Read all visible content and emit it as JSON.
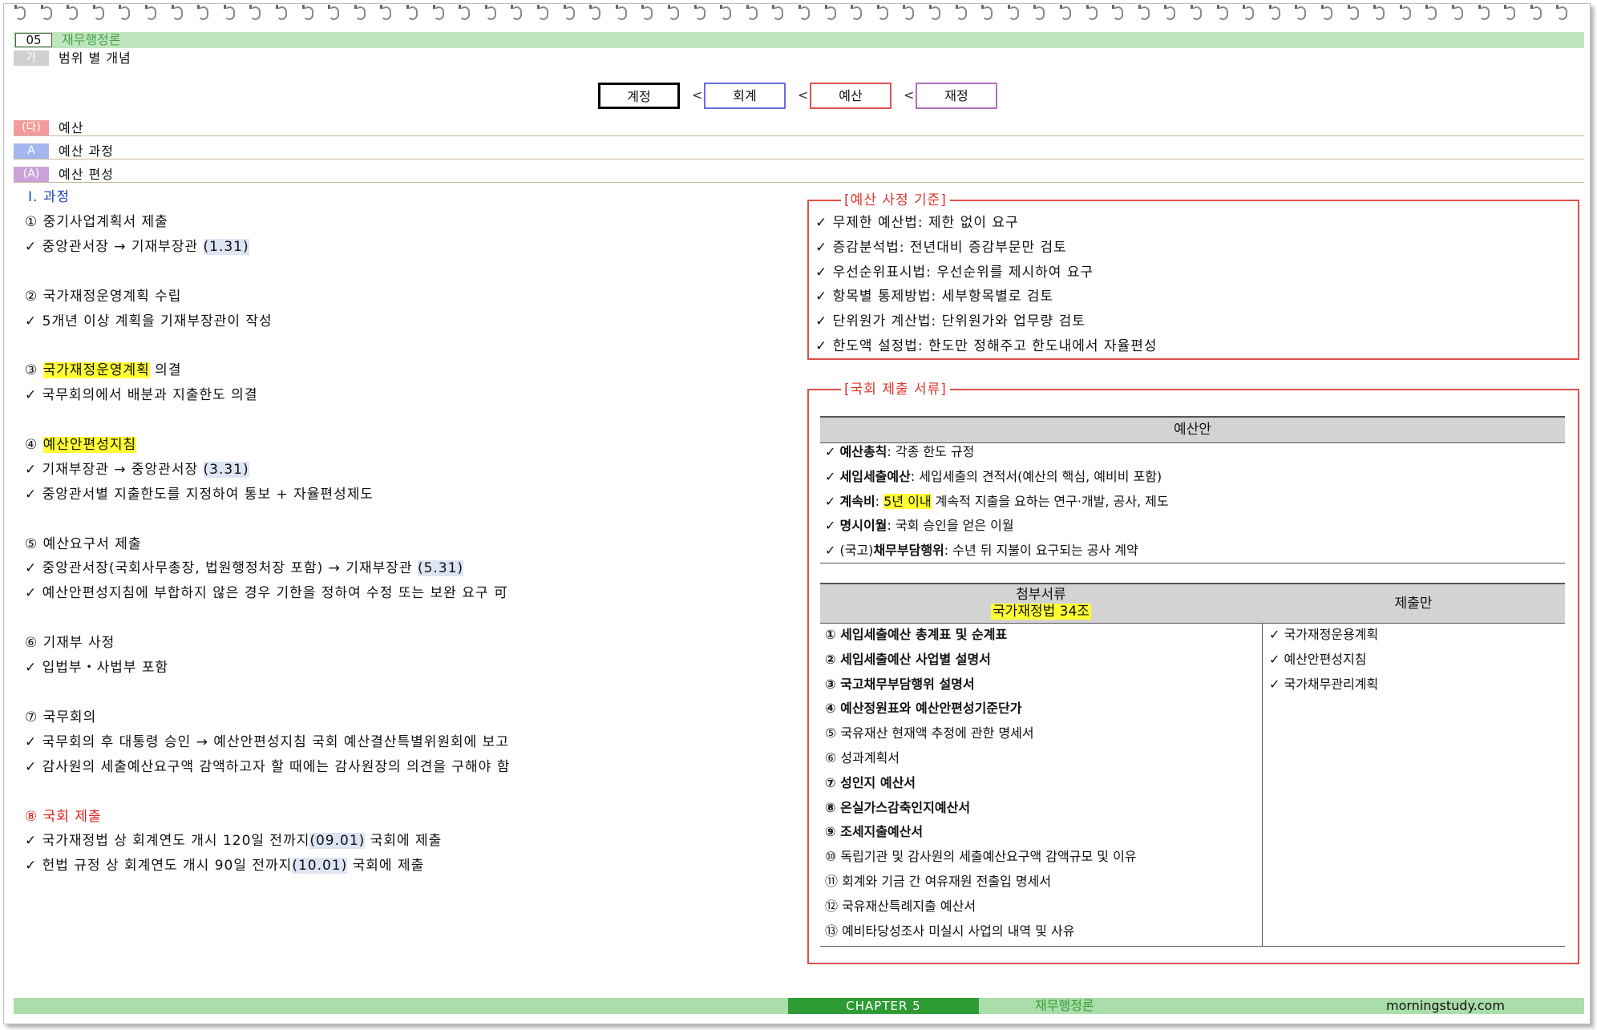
{
  "header": {
    "chapter_num": "05",
    "chapter_title": "재무행정론"
  },
  "sections": [
    {
      "tag": "가",
      "label": "범위 별 개념"
    },
    {
      "tag": "(다)",
      "label": "예산"
    },
    {
      "tag": "A",
      "label": "예산 과정"
    },
    {
      "tag": "(A)",
      "label": "예산 편성"
    }
  ],
  "scope_boxes": [
    {
      "label": "계정",
      "color": "#000000"
    },
    {
      "label": "회계",
      "color": "#6a6ae0"
    },
    {
      "label": "예산",
      "color": "#e05050"
    },
    {
      "label": "재정",
      "color": "#b070c0"
    }
  ],
  "lt_symbol": "<",
  "process": {
    "title": "Ⅰ. 과정",
    "s1": {
      "head": "① 중기사업계획서 제출",
      "c1a": "✓ 중앙관서장 → 기재부장관 ",
      "c1b": "(1.31)"
    },
    "s2": {
      "head": "② 국가재정운영계획 수립",
      "c1": "✓ 5개년 이상 계획을 기재부장관이 작성"
    },
    "s3": {
      "num": "③ ",
      "hl": "국가재정운영계획",
      "rest": " 의결",
      "c1": "✓ 국무회의에서 배분과 지출한도 의결"
    },
    "s4": {
      "num": "④ ",
      "hl": "예산안편성지침",
      "c1a": "✓ 기재부장관 → 중앙관서장 ",
      "c1b": "(3.31)",
      "c2": "✓ 중앙관서별 지출한도를 지정하여 통보 + 자율편성제도"
    },
    "s5": {
      "head": "⑤ 예산요구서 제출",
      "c1a": "✓ 중앙관서장(국회사무총장, 법원행정처장 포함) → 기재부장관 ",
      "c1b": "(5.31)",
      "c2": "✓ 예산안편성지침에 부합하지 않은 경우 기한을 정하여 수정 또는 보완 요구 可"
    },
    "s6": {
      "head": "⑥ 기재부 사정",
      "c1": "✓ 입법부・사법부 포함"
    },
    "s7": {
      "head": "⑦ 국무회의",
      "c1": "✓ 국무회의 후 대통령 승인 → 예산안편성지침 국회 예산결산특별위원회에 보고",
      "c2": "✓ 감사원의 세출예산요구액 감액하고자 할 때에는 감사원장의 의견을 구해야 함"
    },
    "s8": {
      "head": "⑧ 국회 제출",
      "c1a": "✓ 국가재정법 상 회계연도 개시 120일 전까지",
      "c1b": "(09.01)",
      "c1c": " 국회에 제출",
      "c2a": "✓ 헌법 규정 상 회계연도 개시 90일 전까지",
      "c2b": "(10.01)",
      "c2c": " 국회에 제출"
    }
  },
  "criteria": {
    "legend": "[예산 사정 기준]",
    "items": [
      "✓ 무제한 예산법: 제한 없이 요구",
      "✓ 증감분석법: 전년대비 증감부문만 검토",
      "✓ 우선순위표시법: 우선순위를 제시하여 요구",
      "✓ 항목별 통제방법: 세부항목별로 검토",
      "✓ 단위원가 계산법: 단위원가와 업무량 검토",
      "✓ 한도액 설정법: 한도만 정해주고 한도내에서 자율편성"
    ]
  },
  "documents": {
    "legend": "[국회 제출 서류]",
    "budget_header": "예산안",
    "budget_items": [
      {
        "b": "예산총칙",
        "r": ": 각종 한도 규정"
      },
      {
        "b": "세입세출예산",
        "r": ": 세입세출의 견적서(예산의 핵심, 예비비 포함)"
      },
      {
        "b": "계속비",
        "r1": ": ",
        "hl": "5년 이내",
        "r": " 계속적 지출을 요하는 연구·개발, 공사, 제도"
      },
      {
        "b": "명시이월",
        "r": ": 국회 승인을 얻은 이월"
      },
      {
        "pre": "(국고)",
        "b": "채무부담행위",
        "r": ": 수년 뒤 지불이 요구되는 공사 계약"
      }
    ],
    "check": "✓",
    "attach_header": "첨부서류",
    "attach_sub": "국가재정법 34조",
    "submit_header": "제출만",
    "attach_items": [
      {
        "t": "① 세입세출예산 총계표 및 순계표",
        "bold": true
      },
      {
        "t": "② 세입세출예산 사업별 설명서",
        "bold": true
      },
      {
        "t": "③ 국고채무부담행위 설명서",
        "bold": true
      },
      {
        "t": "④ 예산정원표와 예산안편성기준단가",
        "bold": true
      },
      {
        "t": "⑤ 국유재산 현재액 추정에 관한 명세서",
        "bold": false
      },
      {
        "t": "⑥ 성과계획서",
        "bold": false
      },
      {
        "t": "⑦ 성인지 예산서",
        "bold": true
      },
      {
        "t": "⑧ 온실가스감축인지예산서",
        "bold": true
      },
      {
        "t": "⑨ 조세지출예산서",
        "bold": true
      },
      {
        "t": "⑩ 독립기관 및 감사원의 세출예산요구액 감액규모 및 이유",
        "bold": false
      },
      {
        "t": "⑪ 회계와 기금 간 여유재원 전출입 명세서",
        "bold": false
      },
      {
        "t": "⑫ 국유재산특례지출 예산서",
        "bold": false
      },
      {
        "t": "⑬ 예비타당성조사 미실시 사업의 내역 및 사유",
        "bold": false
      }
    ],
    "submit_items": [
      "✓ 국가재정운용계획",
      "✓ 예산안편성지침",
      "✓ 국가채무관리계획"
    ]
  },
  "footer": {
    "chapter": "CHAPTER 5",
    "subject": "재무행정론",
    "site": "morningstudy.com"
  },
  "colors": {
    "tag_ga": "#d0d0d0",
    "tag_da": "#f39b9b",
    "tag_a": "#a3b6ee",
    "tag_a2": "#c9a3d8"
  }
}
